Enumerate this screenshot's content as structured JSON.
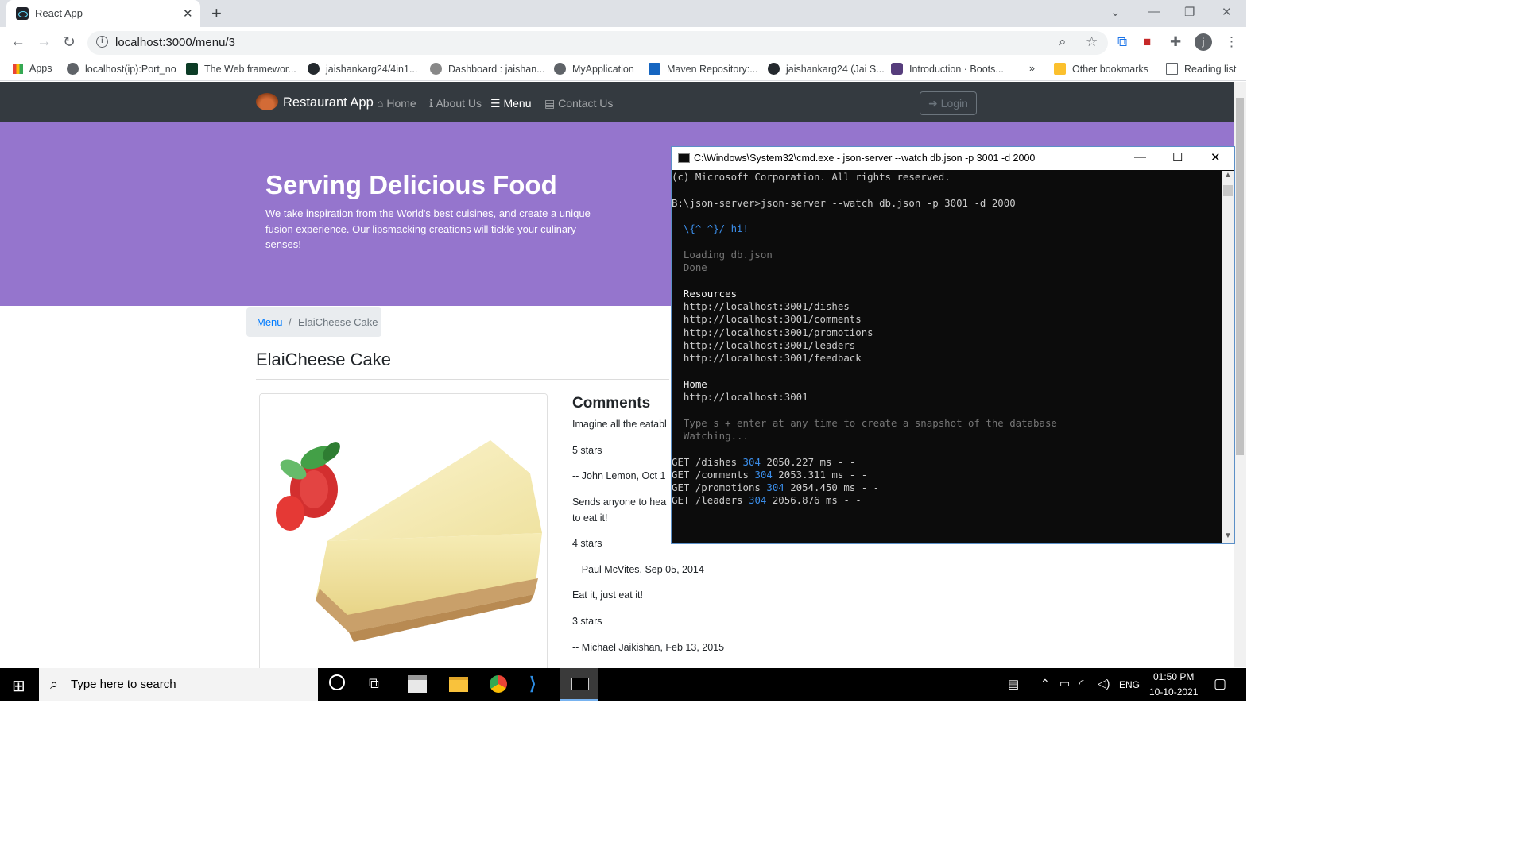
{
  "browser": {
    "tab_title": "React App",
    "tab_close": "✕",
    "new_tab": "+",
    "url": "localhost:3000/menu/3",
    "bookmarks": [
      {
        "label": "Apps"
      },
      {
        "label": "localhost(ip):Port_no"
      },
      {
        "label": "The Web framewor..."
      },
      {
        "label": "jaishankarg24/4in1..."
      },
      {
        "label": "Dashboard : jaishan..."
      },
      {
        "label": "MyApplication"
      },
      {
        "label": "Maven Repository:..."
      },
      {
        "label": "jaishankarg24 (Jai S..."
      },
      {
        "label": "Introduction · Boots..."
      }
    ],
    "bookmarks_more": "»",
    "other_bookmarks": "Other bookmarks",
    "reading_list": "Reading list",
    "profile_initial": "j"
  },
  "navbar": {
    "brand": "Restaurant App",
    "items": [
      {
        "label": "Home",
        "active": false
      },
      {
        "label": "About Us",
        "active": false
      },
      {
        "label": "Menu",
        "active": true
      },
      {
        "label": "Contact Us",
        "active": false
      }
    ],
    "login": "Login"
  },
  "jumbotron": {
    "title": "Serving Delicious Food",
    "text": "We take inspiration from the World's best cuisines, and create a unique fusion experience. Our lipsmacking creations will tickle your culinary senses!"
  },
  "breadcrumb": {
    "link": "Menu",
    "separator": "/",
    "current": "ElaiCheese Cake"
  },
  "dish": {
    "name": "ElaiCheese Cake"
  },
  "comments": {
    "heading": "Comments",
    "lines": [
      "Imagine all the eatabl",
      "5 stars",
      "-- John Lemon, Oct 1",
      "Sends anyone to hea",
      "to eat it!",
      "4 stars",
      "-- Paul McVites, Sep 05, 2014",
      "Eat it, just eat it!",
      "3 stars",
      "-- Michael Jaikishan, Feb 13, 2015"
    ]
  },
  "cmd": {
    "title": "C:\\Windows\\System32\\cmd.exe - json-server  --watch db.json -p 3001 -d 2000",
    "line_copyright": "(c) Microsoft Corporation. All rights reserved.",
    "line_prompt": "B:\\json-server>json-server --watch db.json -p 3001 -d 2000",
    "line_hi": "  \\{^_^}/ hi!",
    "line_loading": "  Loading db.json",
    "line_done": "  Done",
    "resources_title": "  Resources",
    "resources": [
      "  http://localhost:3001/dishes",
      "  http://localhost:3001/comments",
      "  http://localhost:3001/promotions",
      "  http://localhost:3001/leaders",
      "  http://localhost:3001/feedback"
    ],
    "home_title": "  Home",
    "home_url": "  http://localhost:3001",
    "snapshot_hint": "  Type s + enter at any time to create a snapshot of the database",
    "watching": "  Watching...",
    "requests": [
      {
        "prefix": "GET /dishes ",
        "status": "304",
        "suffix": " 2050.227 ms - -"
      },
      {
        "prefix": "GET /comments ",
        "status": "304",
        "suffix": " 2053.311 ms - -"
      },
      {
        "prefix": "GET /promotions ",
        "status": "304",
        "suffix": " 2054.450 ms - -"
      },
      {
        "prefix": "GET /leaders ",
        "status": "304",
        "suffix": " 2056.876 ms - -"
      }
    ]
  },
  "taskbar": {
    "search_placeholder": "Type here to search",
    "language": "ENG",
    "time": "01:50 PM",
    "date": "10-10-2021"
  }
}
